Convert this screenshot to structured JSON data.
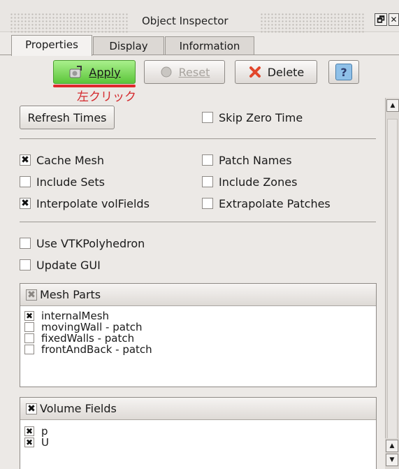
{
  "window": {
    "title": "Object Inspector",
    "float_glyph": "🗗",
    "close_glyph": "✕"
  },
  "tabs": [
    {
      "label": "Properties",
      "active": true
    },
    {
      "label": "Display",
      "active": false
    },
    {
      "label": "Information",
      "active": false
    }
  ],
  "toolbar": {
    "apply_label": "Apply",
    "reset_label": "Reset",
    "delete_label": "Delete",
    "help_label": "?"
  },
  "annotation": {
    "text": "左クリック",
    "color": "#d42a2e"
  },
  "options": {
    "refresh_times_label": "Refresh Times",
    "skip_zero_time": {
      "label": "Skip Zero Time",
      "checked": false
    },
    "cache_mesh": {
      "label": "Cache Mesh",
      "checked": true
    },
    "patch_names": {
      "label": "Patch Names",
      "checked": false
    },
    "include_sets": {
      "label": "Include Sets",
      "checked": false
    },
    "include_zones": {
      "label": "Include Zones",
      "checked": false
    },
    "interpolate_volfields": {
      "label": "Interpolate volFields",
      "checked": true
    },
    "extrapolate_patches": {
      "label": "Extrapolate Patches",
      "checked": false
    },
    "use_vtkpolyhedron": {
      "label": "Use VTKPolyhedron",
      "checked": false
    },
    "update_gui": {
      "label": "Update GUI",
      "checked": false
    }
  },
  "mesh_parts": {
    "header": "Mesh Parts",
    "items": [
      {
        "label": "internalMesh",
        "checked": true
      },
      {
        "label": "movingWall - patch",
        "checked": false
      },
      {
        "label": "fixedWalls - patch",
        "checked": false
      },
      {
        "label": "frontAndBack - patch",
        "checked": false
      }
    ]
  },
  "volume_fields": {
    "header": "Volume Fields",
    "items": [
      {
        "label": "p",
        "checked": true
      },
      {
        "label": "U",
        "checked": true
      }
    ]
  },
  "check_glyph": "✖",
  "colors": {
    "apply_green": "#5cc53a",
    "underline_red": "#e0282c",
    "background": "#ece9e6"
  }
}
